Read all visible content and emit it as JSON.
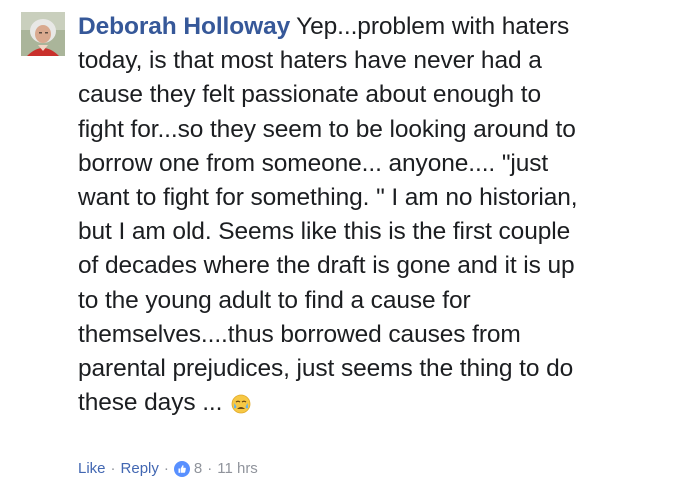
{
  "comment": {
    "author": "Deborah Holloway",
    "lines": [
      "Yep...problem with haters",
      "today, is that most haters have never had a",
      "cause they felt passionate about enough to",
      "fight for...so they seem to be looking around to",
      "borrow one from someone... anyone.... \"just",
      "want to fight for something. \" I am no historian,",
      "but I am old. Seems like this is the first couple",
      "of decades where the draft is gone and it is up",
      "to the young adult to find a cause for",
      "themselves....thus borrowed causes from",
      "parental prejudices, just seems the thing to do",
      "these days ..."
    ],
    "emoji": "crying-face",
    "actions": {
      "like_label": "Like",
      "reply_label": "Reply",
      "separator": "·",
      "reaction_count": "8",
      "timestamp": "11 hrs"
    }
  },
  "colors": {
    "author": "#365899",
    "text": "#1c1e21",
    "link": "#4267b2",
    "meta": "#90949c",
    "like_badge": "#5890ff"
  }
}
